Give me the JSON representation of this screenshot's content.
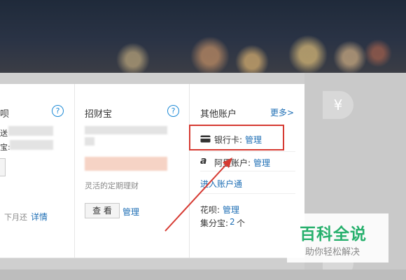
{
  "col1": {
    "title": "呗",
    "help": "?",
    "line1": "送",
    "line2": "宝:",
    "repay_text": "下月还",
    "repay_link": "详情"
  },
  "col2": {
    "title": "招财宝",
    "help": "?",
    "desc": "灵活的定期理财",
    "view_btn": "查 看",
    "manage_link": "管理"
  },
  "col3": {
    "title": "其他账户",
    "more_link": "更多>",
    "bankcard_label": "银行卡:",
    "bankcard_link": "管理",
    "alipay_label": "阿里账户:",
    "alipay_link": "管理",
    "enter_link": "进入账户通",
    "huabei_label": "花呗:",
    "huabei_link": "管理",
    "jifenbao_label": "集分宝:",
    "jifenbao_count": "2",
    "jifenbao_unit": "个"
  },
  "side": {
    "yen_icon": "¥"
  },
  "watermark": {
    "title": "百科全说",
    "subtitle": "助你轻松解决"
  },
  "colors": {
    "link": "#1f6fb5",
    "highlight": "#d63a32",
    "watermark": "#27b06d"
  }
}
